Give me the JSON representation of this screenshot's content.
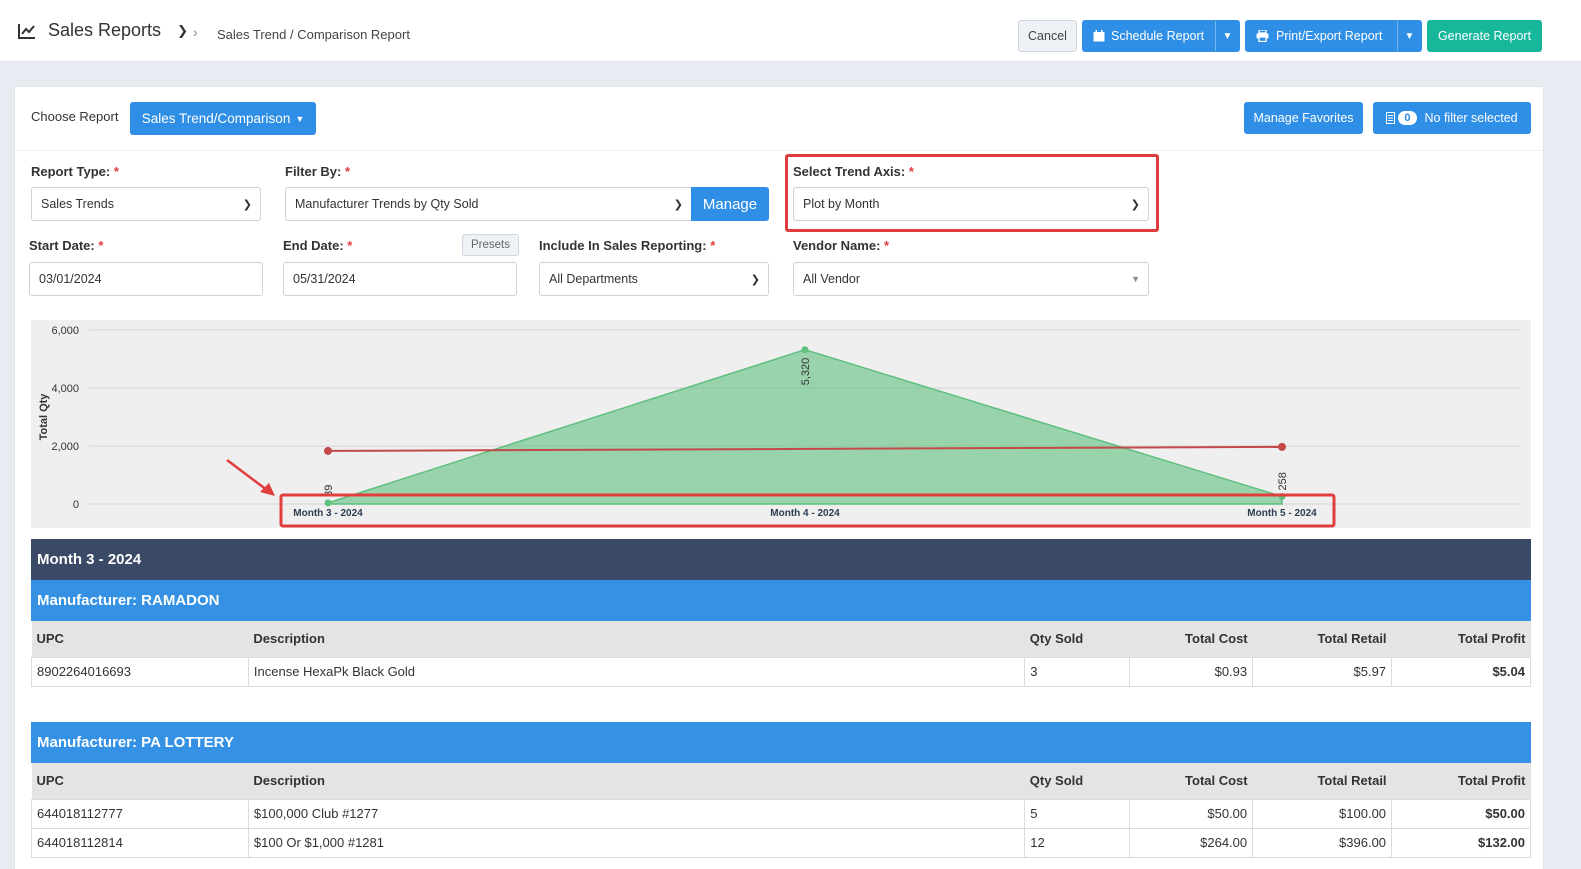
{
  "header": {
    "title": "Sales Reports",
    "breadcrumb": "Sales Trend / Comparison Report",
    "cancel": "Cancel",
    "schedule": "Schedule Report",
    "print": "Print/Export Report",
    "generate": "Generate Report"
  },
  "choose": {
    "label": "Choose Report",
    "report": "Sales Trend/Comparison",
    "favorites": "Manage Favorites",
    "filter_count": "0",
    "filter_text": "No filter selected"
  },
  "form": {
    "report_type_label": "Report Type:",
    "report_type": "Sales Trends",
    "filter_by_label": "Filter By:",
    "filter_by": "Manufacturer Trends by Qty Sold",
    "manage": "Manage",
    "trend_axis_label": "Select Trend Axis:",
    "trend_axis": "Plot by Month",
    "start_label": "Start Date:",
    "start": "03/01/2024",
    "end_label": "End Date:",
    "end": "05/31/2024",
    "presets": "Presets",
    "include_label": "Include In Sales Reporting:",
    "include": "All Departments",
    "vendor_label": "Vendor Name:",
    "vendor": "All Vendor",
    "required_mark": "*"
  },
  "chart_data": {
    "type": "area",
    "ylabel": "Total Qty",
    "ylim": [
      0,
      6000
    ],
    "yticks": [
      "0",
      "2,000",
      "4,000",
      "6,000"
    ],
    "categories": [
      "Month 3 - 2024",
      "Month 4 - 2024",
      "Month 5 - 2024"
    ],
    "series": [
      {
        "values": [
          39,
          5320,
          258
        ],
        "labels": [
          "39",
          "5,320",
          "258"
        ],
        "color": "#5fbf7f"
      },
      {
        "values": [
          1830,
          1900,
          1970
        ],
        "color": "#c44a4a"
      }
    ]
  },
  "report": {
    "month": "Month 3 - 2024",
    "columns": [
      "UPC",
      "Description",
      "Qty Sold",
      "Total Cost",
      "Total Retail",
      "Total Profit"
    ],
    "groups": [
      {
        "manufacturer": "Manufacturer: RAMADON",
        "rows": [
          [
            "8902264016693",
            "Incense HexaPk Black Gold",
            "3",
            "$0.93",
            "$5.97",
            "$5.04"
          ]
        ]
      },
      {
        "manufacturer": "Manufacturer: PA LOTTERY",
        "rows": [
          [
            "644018112777",
            "$100,000 Club #1277",
            "5",
            "$50.00",
            "$100.00",
            "$50.00"
          ],
          [
            "644018112814",
            "$100 Or $1,000 #1281",
            "12",
            "$264.00",
            "$396.00",
            "$132.00"
          ]
        ]
      }
    ]
  },
  "colors": {
    "accent": "#2f8ee5",
    "generate": "#16b79b",
    "month_bar": "#3a4a66",
    "highlight": "#e23d3d"
  }
}
